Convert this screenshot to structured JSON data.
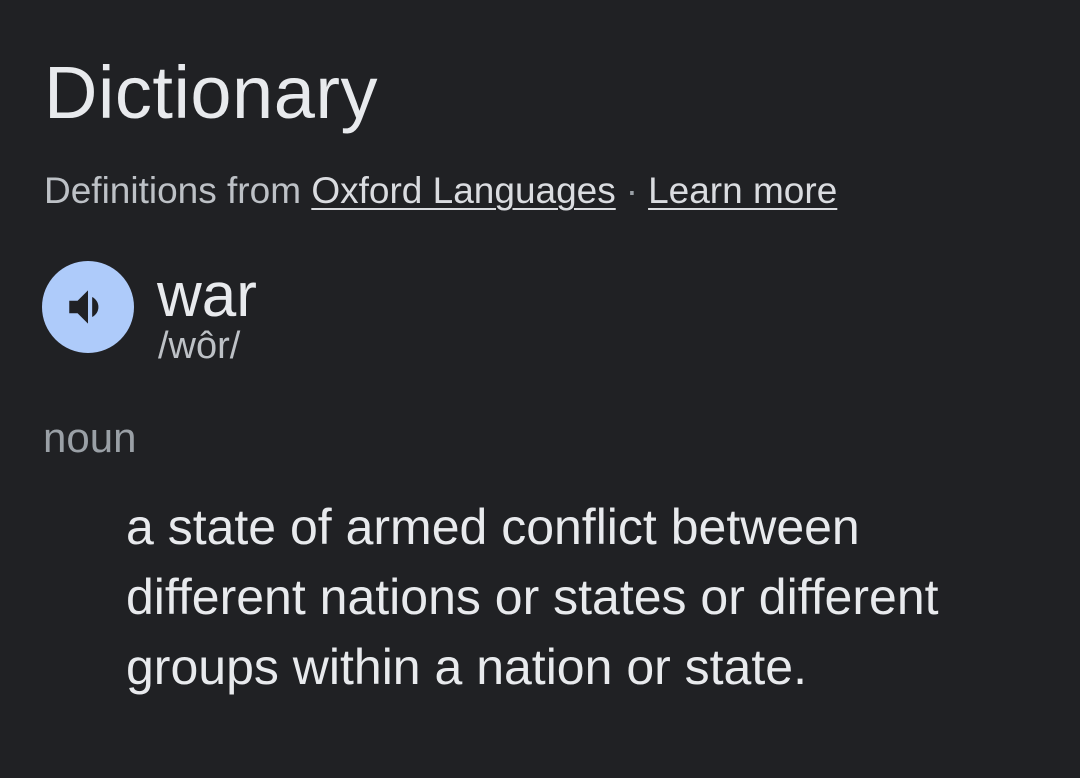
{
  "header": {
    "title": "Dictionary"
  },
  "source": {
    "prefix": "Definitions from",
    "provider_link": "Oxford Languages",
    "separator": "·",
    "learn_more_link": "Learn more"
  },
  "entry": {
    "word": "war",
    "phonetic": "/wôr/",
    "speaker_icon": "speaker-icon",
    "part_of_speech": "noun",
    "definition": "a state of armed conflict between different nations or states or different groups within a nation or state."
  },
  "colors": {
    "background": "#202124",
    "speaker_button": "#aecbfa",
    "primary_text": "#e8eaed",
    "secondary_text": "#9aa0a6"
  }
}
